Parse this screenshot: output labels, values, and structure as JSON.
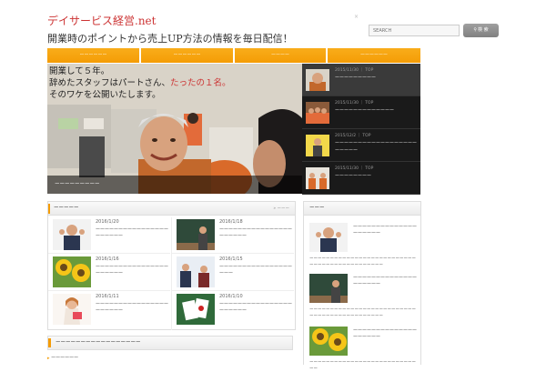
{
  "header": {
    "site_title": "デイサービス経営.net",
    "tagline": "開業時のポイントから売上UP方法の情報を毎日配信！",
    "corner_mark": "×"
  },
  "search": {
    "placeholder": "SEARCH",
    "button_label": "検 索",
    "button_icon": "search-icon"
  },
  "nav": {
    "items": [
      {
        "label": "ーーーーーー"
      },
      {
        "label": "ーーーーーー"
      },
      {
        "label": "ーーーー"
      },
      {
        "label": "ーーーーーー"
      }
    ]
  },
  "slider": {
    "headline_line1": "開業して５年。",
    "headline_line2_pre": "辞めたスタッフはパートさん、",
    "headline_line2_hl": "たったの１名。",
    "headline_line3": "そのワケを公開いたします。",
    "caption": "ーーーーーーーーー",
    "highlight_color": "#cc3333",
    "items": [
      {
        "meta": "2015/11/30 ｜ TOP",
        "title": "ーーーーーーーーー",
        "thumb": "elderly-woman-photo"
      },
      {
        "meta": "2015/11/30 ｜ TOP",
        "title": "ーーーーーーーーーーーーー",
        "thumb": "group-photo"
      },
      {
        "meta": "2015/12/2 ｜ TOP",
        "title": "ーーーーーーーーーーーーーーーーーーーーーーー",
        "thumb": "man-pointing-photo"
      },
      {
        "meta": "2015/11/30 ｜ TOP",
        "title": "ーーーーーーーー",
        "thumb": "staff-photo"
      }
    ]
  },
  "new_posts": {
    "title": "ーーーーー",
    "more": "» ーーー",
    "posts": [
      {
        "date": "2016/1/20",
        "title": "ーーーーーーーーーーーーーーーーーーーーーー",
        "thumb": "man-fist-photo"
      },
      {
        "date": "2016/1/18",
        "title": "ーーーーーーーーーーーーーーーーーーーーーー",
        "thumb": "woman-blackboard-photo"
      },
      {
        "date": "2016/1/16",
        "title": "ーーーーーーーーーーーーーーーーーーーーーー",
        "thumb": "sunflower-photo"
      },
      {
        "date": "2016/1/15",
        "title": "ーーーーーーーーーーーーーーーーーーー",
        "thumb": "business-people-photo"
      },
      {
        "date": "2016/1/11",
        "title": "ーーーーーーーーーーーーーーーーーーーーーー",
        "thumb": "woman-gift-photo"
      },
      {
        "date": "2016/1/10",
        "title": "ーーーーーーーーーーーーーーーーーーーーーー",
        "thumb": "cards-photo"
      }
    ]
  },
  "bottom_section": {
    "title": "ーーーーーーーーーーーーーーーーー",
    "link": "ーーーーーー"
  },
  "sidebar": {
    "title": "ーーー",
    "posts": [
      {
        "title": "ーーーーーーーーーーーーーーーーーーーー",
        "excerpt": "ーーーーーーーーーーーーーーーーーーーーーーーーーーーーーーーーーーーーーーーーーーーー",
        "thumb": "man-fist-photo"
      },
      {
        "title": "ーーーーーーーーーーーーーーーーーーーー",
        "excerpt": "ーーーーーーーーーーーーーーーーーーーーーーーーーーーーーーーーーーーーーーーーーーーー",
        "thumb": "woman-blackboard-photo"
      },
      {
        "title": "ーーーーーーーーーーーーーーーーーーーー",
        "excerpt": "ーーーーーーーーーーーーーーーーーーーーーーーーーーーー",
        "thumb": "sunflower-photo"
      }
    ]
  },
  "colors": {
    "accent": "#f49c06",
    "title_red": "#cc3333",
    "dark_panel": "#1a1a1a"
  }
}
